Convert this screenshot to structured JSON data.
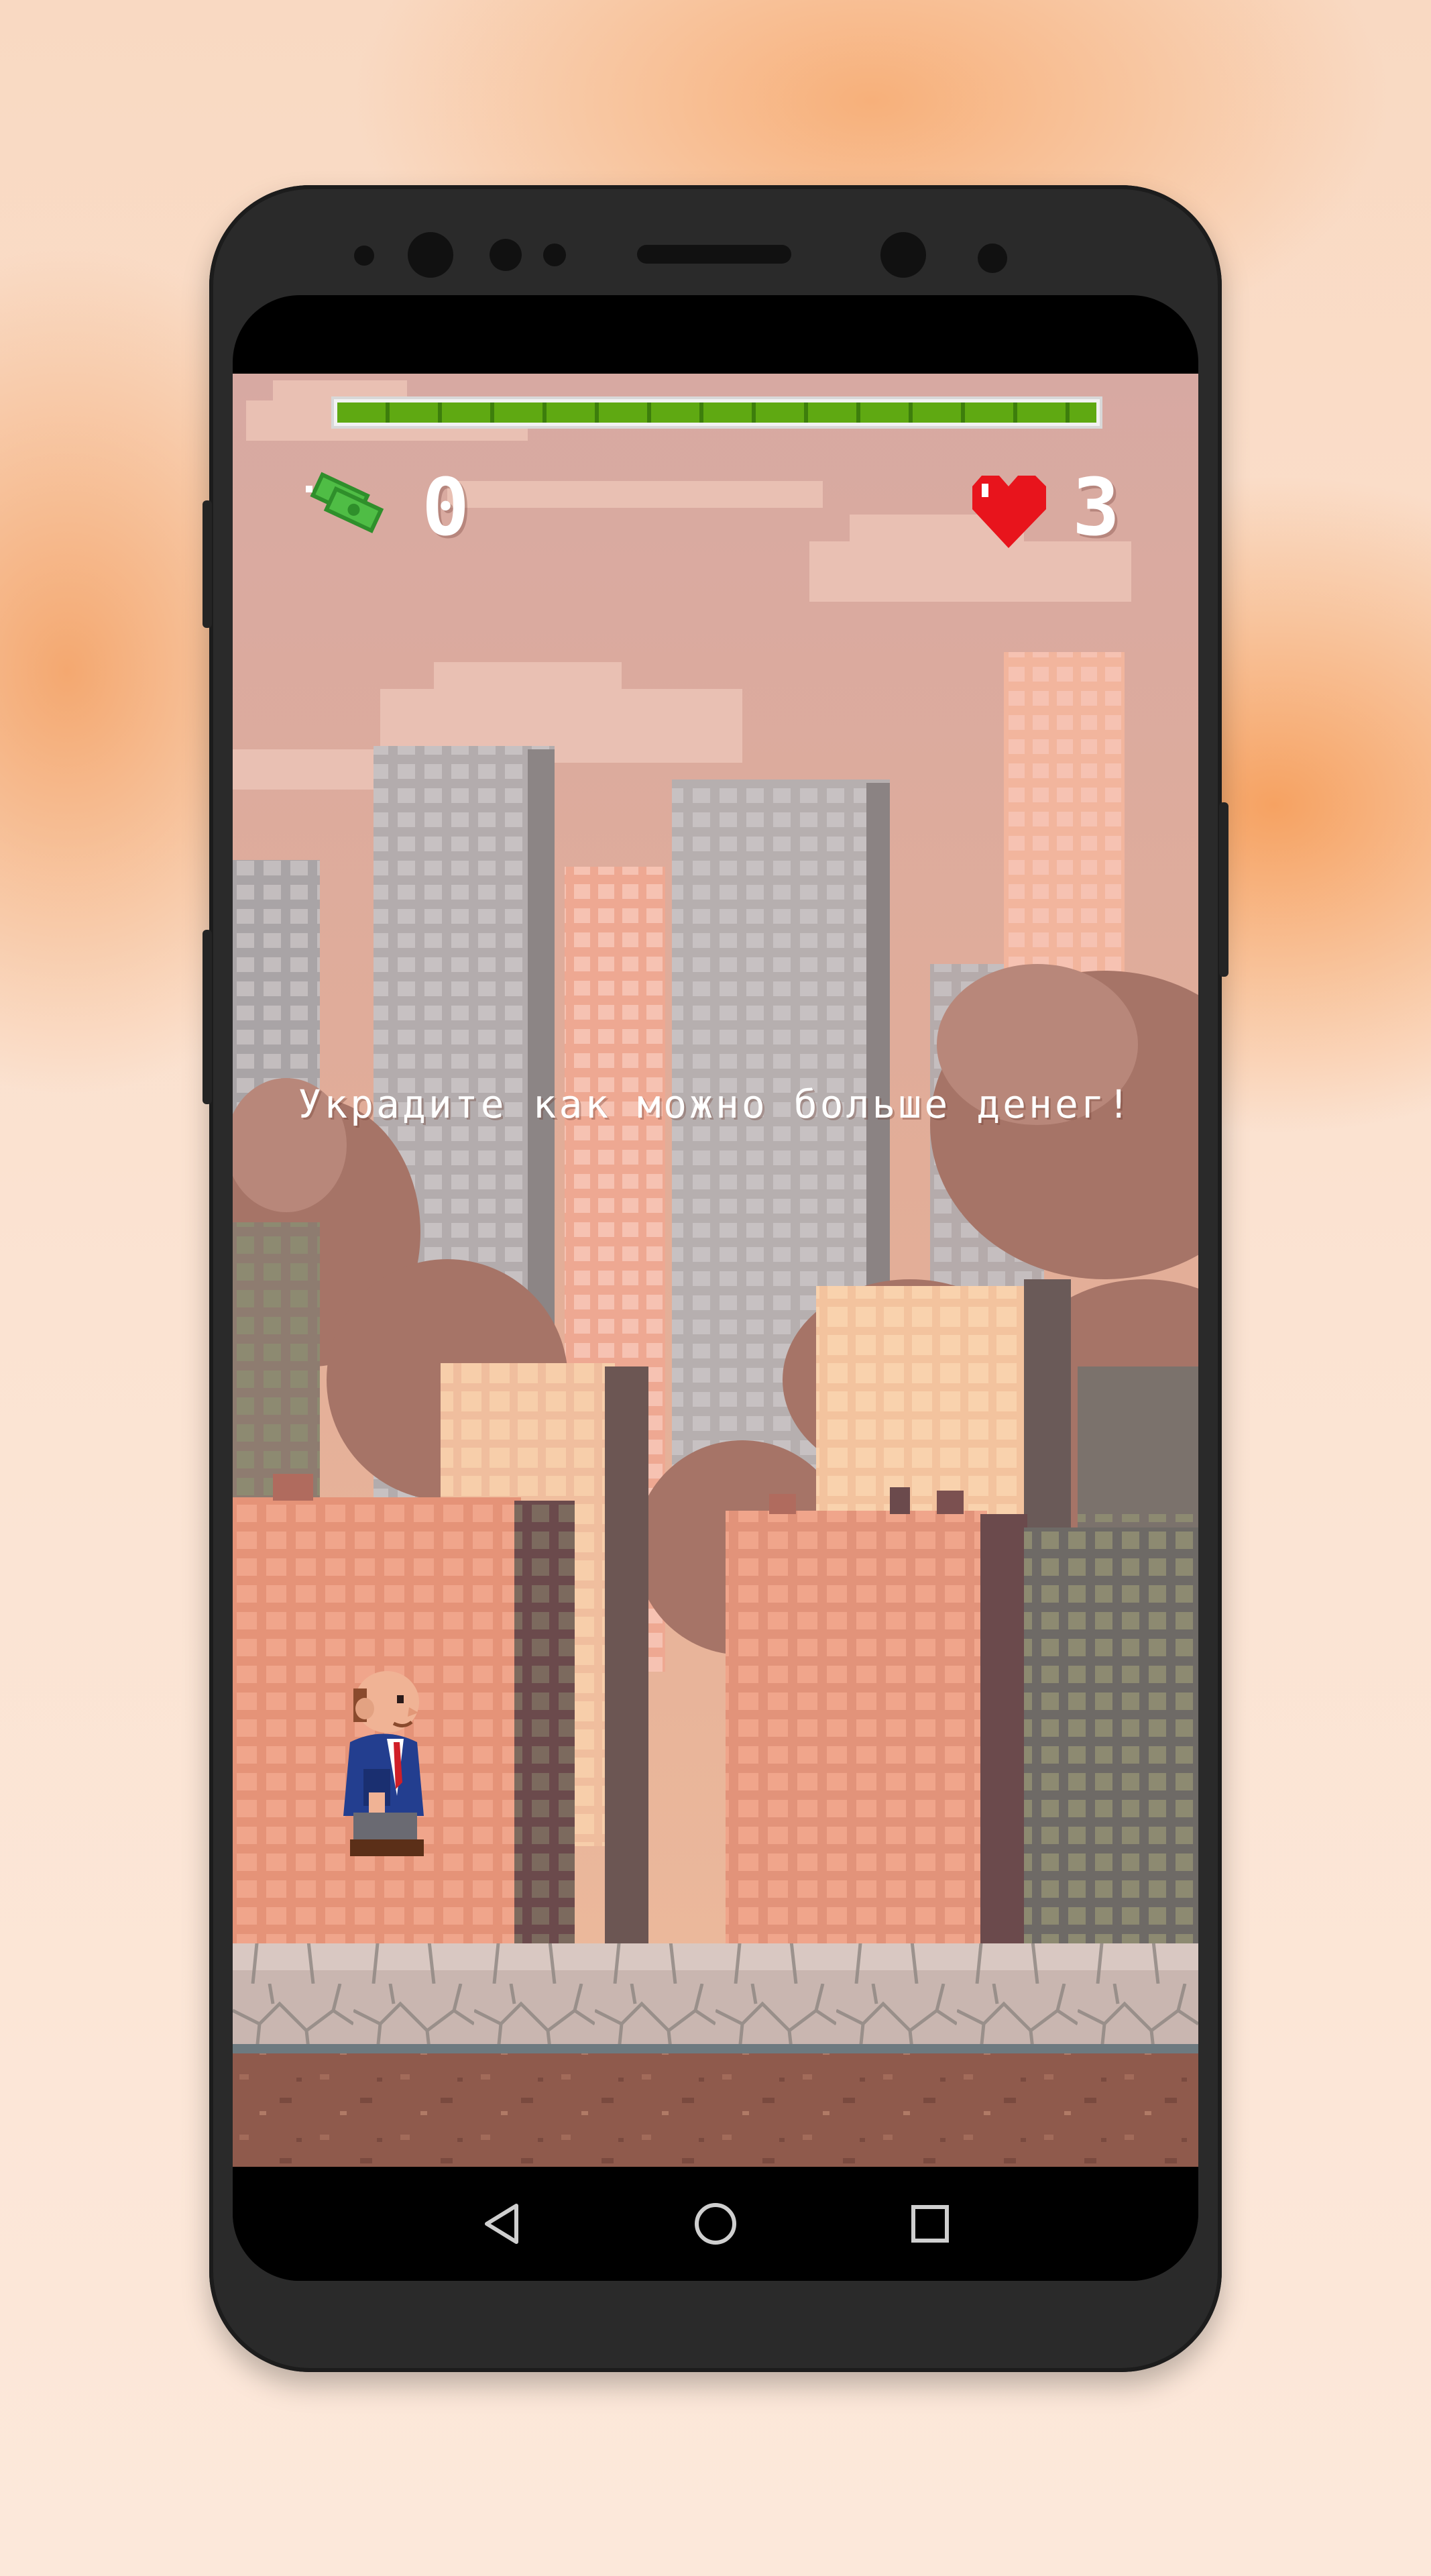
{
  "game": {
    "progress": 1.0,
    "money_count": "0",
    "lives_count": "3",
    "message": "Украдите как можно больше денег!",
    "colors": {
      "progress_fill": "#5fa912",
      "heart": "#e8141c",
      "cash": "#3ca33a",
      "sky": "#d9aaa2"
    }
  },
  "icons": {
    "money": "cash-stack-icon",
    "lives": "heart-icon",
    "nav_back": "triangle-back-icon",
    "nav_home": "circle-home-icon",
    "nav_recents": "square-recents-icon"
  }
}
